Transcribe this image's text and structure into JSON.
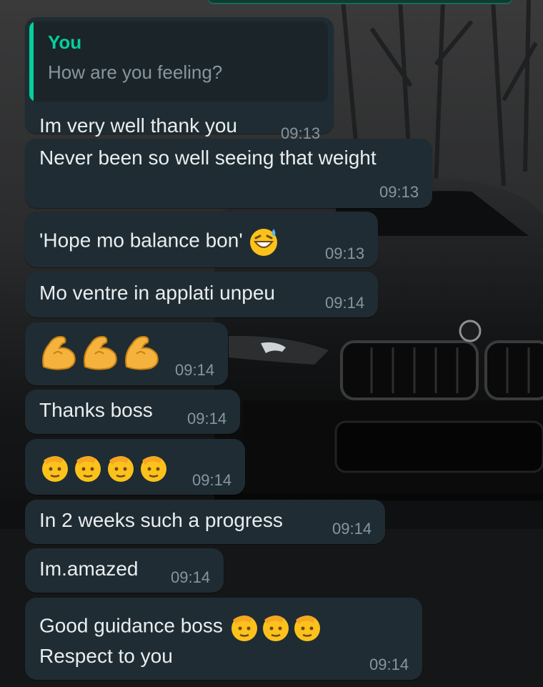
{
  "chat": {
    "quoted_message": {
      "author": "You",
      "text": "How are you feeling?"
    },
    "messages": [
      {
        "text": "Im very well thank you",
        "time": "09:13"
      },
      {
        "text": "Never been so well seeing that weight",
        "time": "09:13"
      },
      {
        "text": "'Hope mo balance bon'",
        "emoji": "sweat-smile",
        "time": "09:13"
      },
      {
        "text": "Mo ventre in applati unpeu",
        "time": "09:14"
      },
      {
        "emoji": "flexed-biceps",
        "emoji_count": 3,
        "time": "09:14"
      },
      {
        "text": "Thanks boss",
        "time": "09:14"
      },
      {
        "emoji": "saluting-face",
        "emoji_count": 4,
        "time": "09:14"
      },
      {
        "text": "In 2 weeks such a progress",
        "time": "09:14"
      },
      {
        "text": "Im.amazed",
        "time": "09:14"
      },
      {
        "lines": [
          "Good guidance boss",
          "Respect to you"
        ],
        "emoji": "saluting-face",
        "emoji_count": 3,
        "time": "09:14"
      }
    ]
  },
  "colors": {
    "bubble": "#1f2c33",
    "text": "#e9edef",
    "timestamp": "#8696a0",
    "quote_accent": "#06cf9c"
  }
}
